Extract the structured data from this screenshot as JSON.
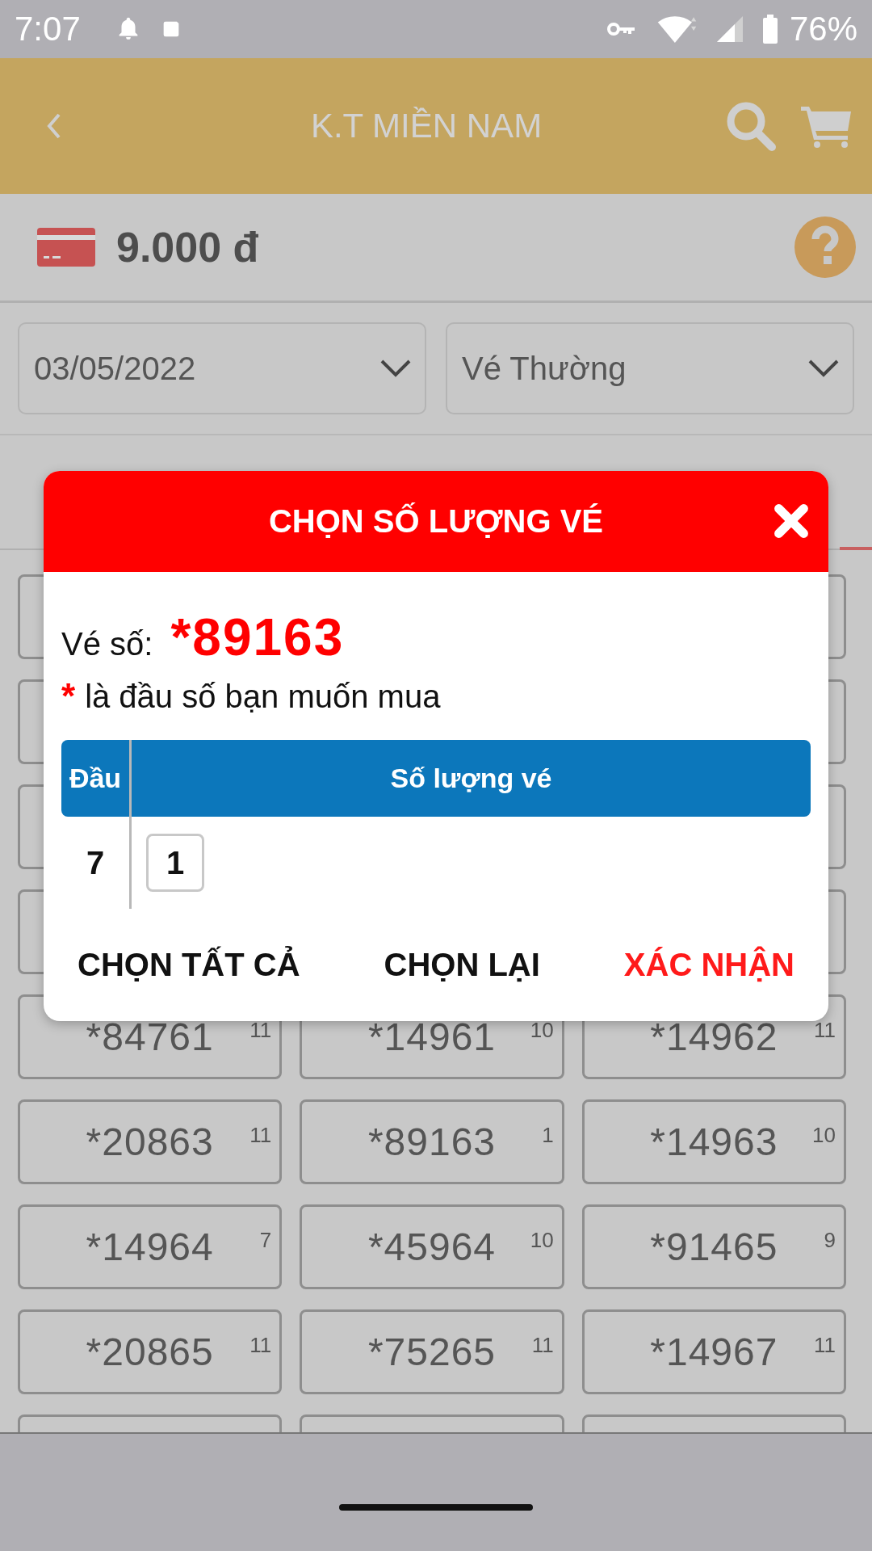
{
  "status_bar": {
    "time": "7:07",
    "battery": "76%"
  },
  "app_bar": {
    "title": "K.T MIỀN NAM"
  },
  "balance": {
    "amount": "9.000 đ"
  },
  "filters": [
    {
      "value": "03/05/2022"
    },
    {
      "value": "Vé Thường"
    }
  ],
  "tickets": [
    {
      "number": "*84761",
      "count": "11"
    },
    {
      "number": "*14961",
      "count": "10"
    },
    {
      "number": "*14962",
      "count": "11"
    },
    {
      "number": "*20863",
      "count": "11"
    },
    {
      "number": "*89163",
      "count": "1"
    },
    {
      "number": "*14963",
      "count": "10"
    },
    {
      "number": "*14964",
      "count": "7"
    },
    {
      "number": "*45964",
      "count": "10"
    },
    {
      "number": "*91465",
      "count": "9"
    },
    {
      "number": "*20865",
      "count": "11"
    },
    {
      "number": "*75265",
      "count": "11"
    },
    {
      "number": "*14967",
      "count": "11"
    }
  ],
  "dialog": {
    "title": "CHỌN SỐ LƯỢNG VÉ",
    "ticket_label": "Vé số:",
    "ticket_number": "*89163",
    "hint_mark": "*",
    "hint": "là đầu số bạn muốn mua",
    "table": {
      "columns": [
        "Đầu",
        "Số lượng vé"
      ],
      "rows": [
        {
          "head": "7",
          "quantity": "1"
        }
      ]
    },
    "buttons": [
      {
        "label": "CHỌN TẤT CẢ",
        "kind": "plain"
      },
      {
        "label": "CHỌN LẠI",
        "kind": "plain"
      },
      {
        "label": "XÁC NHẬN",
        "kind": "primary"
      }
    ]
  }
}
